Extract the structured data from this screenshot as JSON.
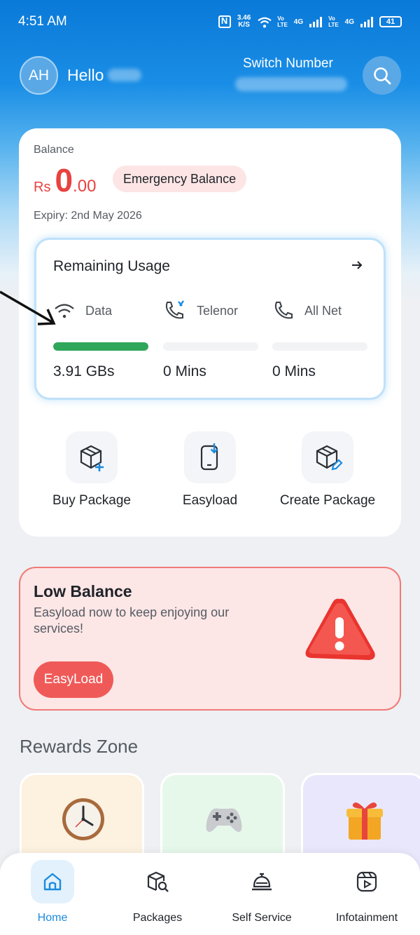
{
  "status_bar": {
    "time": "4:51 AM",
    "speed_value": "3.46",
    "speed_unit": "K/S",
    "vo_top": "Vo",
    "vo_bottom": "LTE",
    "net_1": "4G",
    "net_2": "4G",
    "battery": "41"
  },
  "header": {
    "avatar_initials": "AH",
    "greeting": "Hello",
    "switch_label": "Switch Number"
  },
  "balance": {
    "label": "Balance",
    "currency": "Rs",
    "integer": "0",
    "decimal": ".00",
    "emergency_label": "Emergency Balance",
    "expiry": "Expiry: 2nd May 2026"
  },
  "usage": {
    "title": "Remaining Usage",
    "items": [
      {
        "label": "Data",
        "value": "3.91 GBs",
        "fill_percent": 100
      },
      {
        "label": "Telenor",
        "value": "0 Mins",
        "fill_percent": 0
      },
      {
        "label": "All Net",
        "value": "0 Mins",
        "fill_percent": 0
      }
    ]
  },
  "quick_actions": [
    {
      "label": "Buy Package"
    },
    {
      "label": "Easyload"
    },
    {
      "label": "Create Package"
    }
  ],
  "low_balance": {
    "title": "Low Balance",
    "description": "Easyload now to keep enjoying our services!",
    "button": "EasyLoad"
  },
  "rewards": {
    "title": "Rewards Zone",
    "items": [
      {
        "icon": "clock-icon",
        "bg": "#fdf1df"
      },
      {
        "icon": "gamepad-icon",
        "bg": "#e6f8ea"
      },
      {
        "icon": "gift-icon",
        "bg": "#e9e7fb"
      }
    ]
  },
  "nav": {
    "items": [
      {
        "label": "Home",
        "active": true
      },
      {
        "label": "Packages"
      },
      {
        "label": "Self Service"
      },
      {
        "label": "Infotainment"
      }
    ]
  },
  "colors": {
    "brand_blue": "#1b8be0",
    "balance_red": "#e8423f",
    "data_green": "#2fa65a",
    "alert_red": "#ef5a58"
  }
}
